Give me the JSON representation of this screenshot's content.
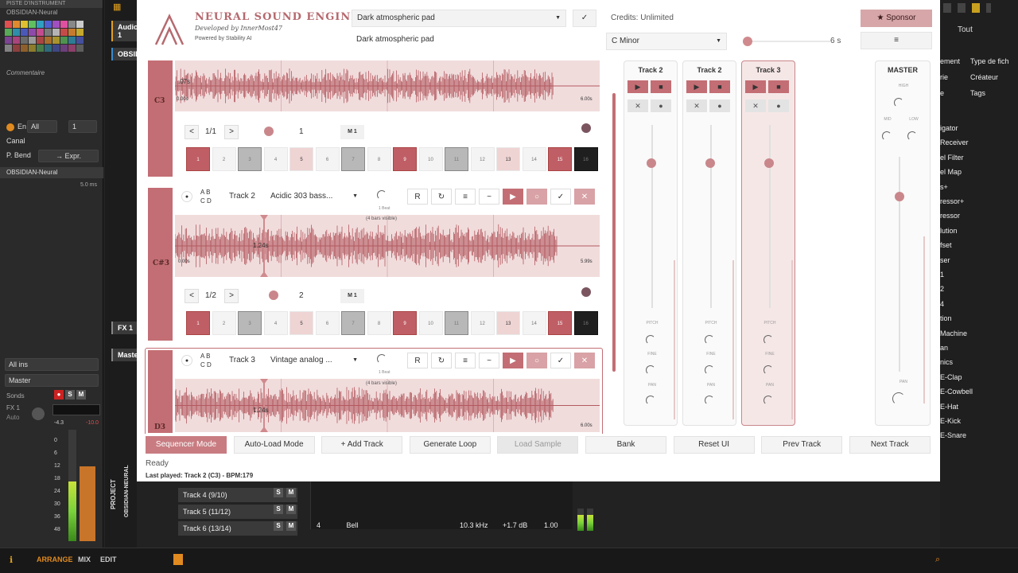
{
  "daw": {
    "left": {
      "header": "PISTE D'INSTRUMENT",
      "plugin_name": "OBSIDIAN-Neural",
      "comment_label": "Commentaire",
      "status": "En service",
      "channel_label": "Canal",
      "channel_value": "All",
      "channel_num": "1",
      "pbend_label": "P. Bend",
      "pbend_value": "→ Expr.",
      "device": "OBSIDIAN-Neural",
      "device_time": "5.0 ms",
      "all_ins": "All ins",
      "master": "Master",
      "sends": "Sonds",
      "fx_label": "FX 1",
      "auto": "Auto",
      "meter_l": "-4.3",
      "meter_r": "-10.0",
      "scale": [
        "0",
        "6",
        "12",
        "18",
        "24",
        "30",
        "36",
        "48"
      ]
    },
    "mid": {
      "audio": "Audio 1",
      "obs": "OBSIDI",
      "fx1": "FX 1",
      "master": "Master",
      "project": "PROJECT",
      "obs_vert": "OBSIDIAN-NEURAL"
    },
    "right": {
      "tab": "Tout",
      "items": [
        "ement",
        "Type de fich",
        "rie",
        "Créateur",
        "e",
        "Tags",
        "igator",
        "Receiver",
        "el Filter",
        "el Map",
        "s+",
        "ressor+",
        "ressor",
        "lution",
        "fset",
        "ser",
        "1",
        "2",
        "4",
        "tion",
        "Machine",
        "an",
        "nics",
        "E-Clap",
        "E-Cowbell",
        "E-Hat",
        "E-Kick",
        "E-Snare"
      ]
    },
    "lower": {
      "tracks": [
        "Track 4 (9/10)",
        "Track 5 (11/12)",
        "Track 6 (13/14)"
      ],
      "bell_num": "4",
      "bell": "Bell",
      "freq": "10.3 kHz",
      "gain": "+1.7 dB",
      "q": "1.00"
    },
    "bottom": [
      "ARRANGE",
      "MIX",
      "EDIT"
    ]
  },
  "plugin": {
    "title": "NEURAL SOUND ENGINE",
    "subtitle": "Developed by InnerMost47",
    "powered": "Powered by Stability AI",
    "prompt_value": "Dark atmospheric pad",
    "prompt_echo": "Dark atmospheric pad",
    "confirm": "✓",
    "credits": "Credits: Unlimited",
    "sponsor": "★ Sponsor",
    "key": "C Minor",
    "duration": "6 s",
    "menu": "≡",
    "track1": {
      "note": "C3",
      "time_start": "0.00s",
      "time_end": "6.00s",
      "pos": ".07s",
      "page": "1/1",
      "bpm": "1",
      "m": "M 1"
    },
    "track2": {
      "name": "Track 2",
      "prompt": "Acidic 303 bass...",
      "note": "C#3",
      "beat": "1 Beat",
      "bars": "(4 bars visible)",
      "pos": "1.24s",
      "time_start": "0.00s",
      "time_end": "5.99s",
      "page": "1/2",
      "bpm": "2",
      "m": "M 1",
      "ab": "A B",
      "cd": "C D",
      "btns": [
        "R",
        "↻",
        "≡",
        "~",
        "▶",
        "○",
        "✓",
        "✕"
      ]
    },
    "track3": {
      "name": "Track 3",
      "prompt": "Vintage analog ...",
      "note": "D3",
      "beat": "1 Beat",
      "bars": "(4 bars visible)",
      "pos": "1.24s",
      "time_end": "6.00s",
      "ab": "A B",
      "cd": "C D",
      "btns": [
        "R",
        "↻",
        "≡",
        "~",
        "▶",
        "○",
        "✓",
        "✕"
      ]
    },
    "steps": [
      "1",
      "2",
      "3",
      "4",
      "5",
      "6",
      "7",
      "8",
      "9",
      "10",
      "11",
      "12",
      "13",
      "14",
      "15",
      "16"
    ],
    "buttons": [
      "Sequencer Mode",
      "Auto-Load Mode",
      "+ Add Track",
      "Generate Loop",
      "Load Sample",
      "Bank",
      "Reset UI",
      "Prev Track",
      "Next Track"
    ],
    "status": "Ready",
    "last": "Last played: Track 2 (C3) - BPM:179",
    "mixer": {
      "strips": [
        "Track 2",
        "Track 2",
        "Track 3"
      ],
      "knobs": [
        "PITCH",
        "FINE",
        "PAN"
      ],
      "master": "MASTER",
      "mknobs": [
        "HIGH",
        "MID",
        "LOW",
        "PAN"
      ]
    }
  }
}
